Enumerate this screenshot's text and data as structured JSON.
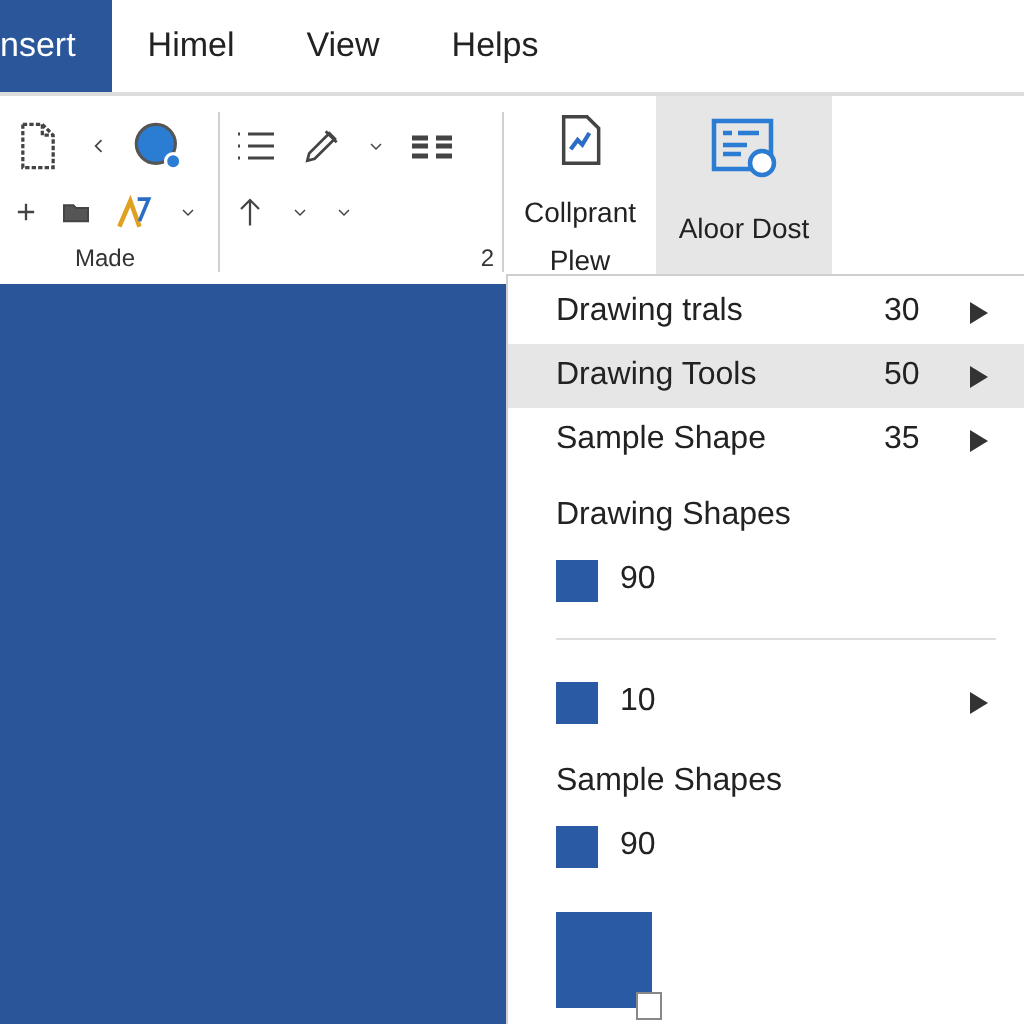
{
  "tabs": [
    {
      "label": "nsert",
      "selected": true
    },
    {
      "label": "Himel",
      "selected": false
    },
    {
      "label": "View",
      "selected": false
    },
    {
      "label": "Helps",
      "selected": false
    }
  ],
  "ribbon": {
    "groups": [
      {
        "label": "Made"
      },
      {
        "label": "2"
      }
    ],
    "large_buttons": [
      {
        "label": "Collprant Plew",
        "selected": false
      },
      {
        "label": "Aloor Dost",
        "selected": true
      }
    ]
  },
  "menu": {
    "items": [
      {
        "kind": "submenu",
        "label": "Drawing trals",
        "value": "30",
        "selected": false
      },
      {
        "kind": "submenu",
        "label": "Drawing Tools",
        "value": "50",
        "selected": true
      },
      {
        "kind": "submenu",
        "label": "Sample Shape",
        "value": "35",
        "selected": false
      },
      {
        "kind": "heading",
        "label": "Drawing Shapes"
      },
      {
        "kind": "swatch",
        "value": "90",
        "color": "#2b5aa5",
        "submenu": false
      },
      {
        "kind": "divider"
      },
      {
        "kind": "swatch",
        "value": "10",
        "color": "#2b5aa5",
        "submenu": true
      },
      {
        "kind": "heading",
        "label": "Sample Shapes"
      },
      {
        "kind": "swatch",
        "value": "90",
        "color": "#2b5aa5",
        "submenu": false
      },
      {
        "kind": "large_swatch",
        "color": "#2b5aa5"
      }
    ]
  }
}
